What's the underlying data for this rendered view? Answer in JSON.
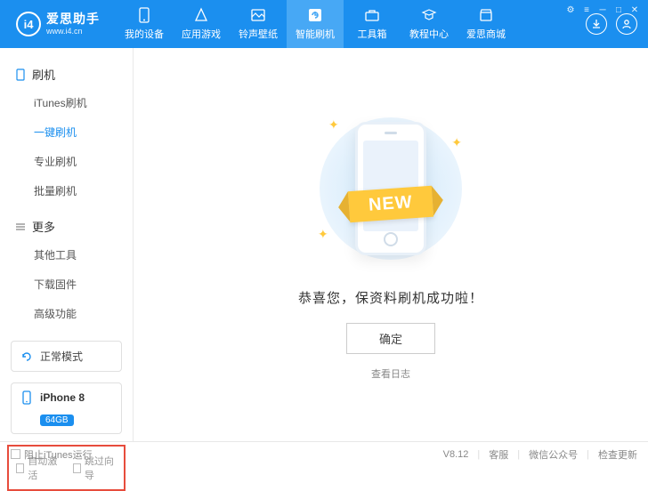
{
  "brand": {
    "name": "爱思助手",
    "url": "www.i4.cn",
    "logo_text": "i4"
  },
  "nav": [
    {
      "label": "我的设备"
    },
    {
      "label": "应用游戏"
    },
    {
      "label": "铃声壁纸"
    },
    {
      "label": "智能刷机"
    },
    {
      "label": "工具箱"
    },
    {
      "label": "教程中心"
    },
    {
      "label": "爱思商城"
    }
  ],
  "sidebar": {
    "section1_title": "刷机",
    "section1_items": [
      "iTunes刷机",
      "一键刷机",
      "专业刷机",
      "批量刷机"
    ],
    "section2_title": "更多",
    "section2_items": [
      "其他工具",
      "下载固件",
      "高级功能"
    ],
    "mode_label": "正常模式",
    "device_name": "iPhone 8",
    "device_storage": "64GB",
    "checkbox_auto": "自动激活",
    "checkbox_skip": "跳过向导"
  },
  "main": {
    "ribbon_text": "NEW",
    "success_msg": "恭喜您，保资料刷机成功啦！",
    "ok_btn": "确定",
    "log_link": "查看日志"
  },
  "footer": {
    "block_itunes": "阻止iTunes运行",
    "version": "V8.12",
    "support": "客服",
    "wechat": "微信公众号",
    "update": "检查更新"
  }
}
